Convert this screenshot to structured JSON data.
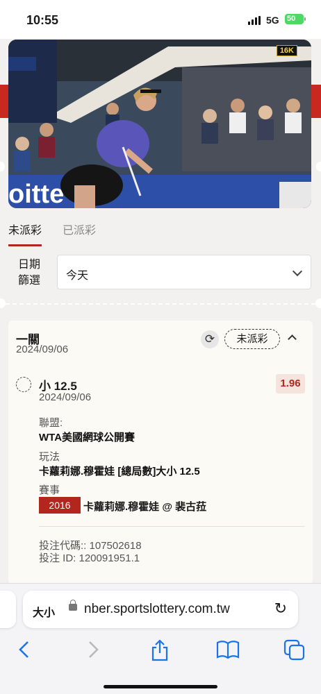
{
  "status_bar": {
    "time": "10:55",
    "network": "5G",
    "battery": "50"
  },
  "video": {
    "quality_badge": "16K"
  },
  "tabs": [
    {
      "label": "未派彩",
      "active": true
    },
    {
      "label": "已派彩",
      "active": false
    }
  ],
  "filter": {
    "label_line1": "日期",
    "label_line2": "篩選",
    "selected": "今天"
  },
  "bet_card": {
    "title": "一關",
    "date": "2024/09/06",
    "status": "未派彩",
    "selection": "小 12.5",
    "selection_date": "2024/09/06",
    "odds": "1.96",
    "league_label": "聯盟:",
    "league": "WTA美國網球公開賽",
    "market_label": "玩法",
    "market": "卡蘿莉娜.穆霍娃 [總局數]大小 12.5",
    "event_label": "賽事",
    "event_year": "2016",
    "event": "卡蘿莉娜.穆霍娃 @ 裴古菈",
    "bet_code": "投注代碼:: 107502618",
    "bet_id": "投注 ID: 120091951.1"
  },
  "browser": {
    "text_size": "大小",
    "url": "nber.sportslottery.com.tw"
  },
  "colors": {
    "accent_red": "#b3261e",
    "ios_blue": "#1a73e8"
  }
}
